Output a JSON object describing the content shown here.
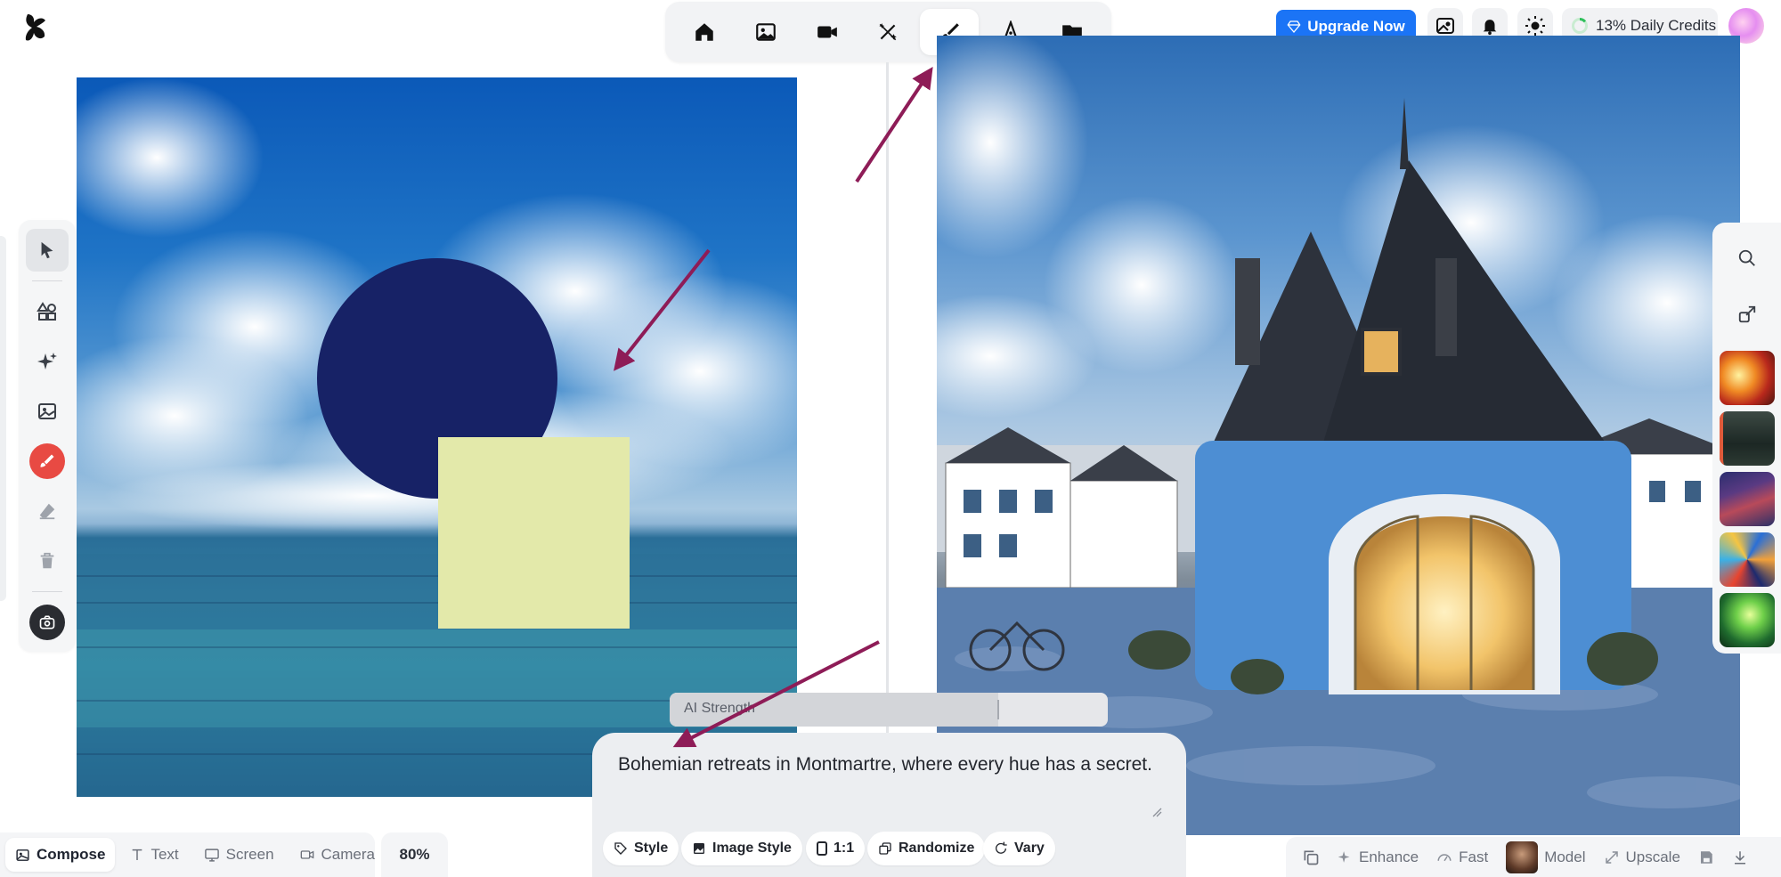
{
  "app": {
    "logo_icon": "app-logo-icon"
  },
  "toolbar": {
    "items": [
      {
        "name": "home",
        "icon": "home-icon"
      },
      {
        "name": "image",
        "icon": "image-icon"
      },
      {
        "name": "video",
        "icon": "video-camera-icon"
      },
      {
        "name": "magic-wand",
        "icon": "magic-wand-icon"
      },
      {
        "name": "draw",
        "icon": "brush-icon",
        "active": true
      },
      {
        "name": "vector",
        "icon": "pen-nib-icon"
      },
      {
        "name": "folder",
        "icon": "folder-icon"
      }
    ]
  },
  "header": {
    "upgrade_label": "Upgrade Now",
    "credits_label": "13% Daily Credits",
    "credits_percent": 13
  },
  "left_tools": {
    "items": [
      "select-icon",
      "shapes-icon",
      "sparkles-icon",
      "image-icon",
      "brush-icon",
      "eraser-icon",
      "trash-icon",
      "camera-capture-icon"
    ]
  },
  "ai_strength": {
    "label": "AI Strength",
    "value": 0.75
  },
  "prompt": {
    "text": "Bohemian retreats in Montmartre, where every hue has a secret.",
    "chips": {
      "style": "Style",
      "image_style": "Image Style",
      "ratio": "1:1",
      "randomize": "Randomize",
      "vary": "Vary"
    }
  },
  "bottom_left": {
    "modes": {
      "compose": "Compose",
      "text": "Text",
      "screen": "Screen",
      "camera": "Camera"
    },
    "zoom": "80%"
  },
  "bottom_right": {
    "enhance": "Enhance",
    "fast": "Fast",
    "model": "Model",
    "upscale": "Upscale"
  },
  "colors": {
    "accent": "#1b74f6",
    "arrow": "#8e1c57",
    "circle": "#172266",
    "square": "#e3e9aa",
    "red_tool": "#e84a43"
  }
}
